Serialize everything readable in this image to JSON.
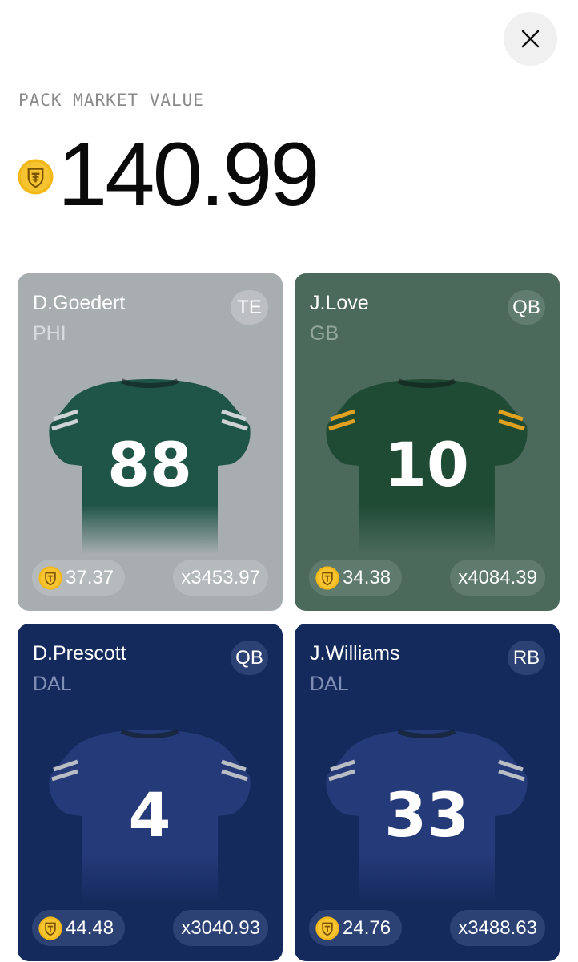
{
  "header": {
    "close_icon": "close-icon",
    "label": "PACK MARKET VALUE",
    "value": "140.99",
    "coin_icon": "coin-shield-icon",
    "coin_color": "#f2b817"
  },
  "cards": [
    {
      "name": "D.Goedert",
      "team": "PHI",
      "position": "TE",
      "number": "88",
      "price": "37.37",
      "multiplier": "x3453.97",
      "background": "#a8adb0",
      "jersey_color": "#1f5547",
      "jersey_accent": "#cfd3d4"
    },
    {
      "name": "J.Love",
      "team": "GB",
      "position": "QB",
      "number": "10",
      "price": "34.38",
      "multiplier": "x4084.39",
      "background": "#4c6a5c",
      "jersey_color": "#1f4b35",
      "jersey_accent": "#e0a020"
    },
    {
      "name": "D.Prescott",
      "team": "DAL",
      "position": "QB",
      "number": "4",
      "price": "44.48",
      "multiplier": "x3040.93",
      "background": "#142a5c",
      "jersey_color": "#253a78",
      "jersey_accent": "#b9bdc4"
    },
    {
      "name": "J.Williams",
      "team": "DAL",
      "position": "RB",
      "number": "33",
      "price": "24.76",
      "multiplier": "x3488.63",
      "background": "#142a5c",
      "jersey_color": "#253a78",
      "jersey_accent": "#b9bdc4"
    }
  ]
}
